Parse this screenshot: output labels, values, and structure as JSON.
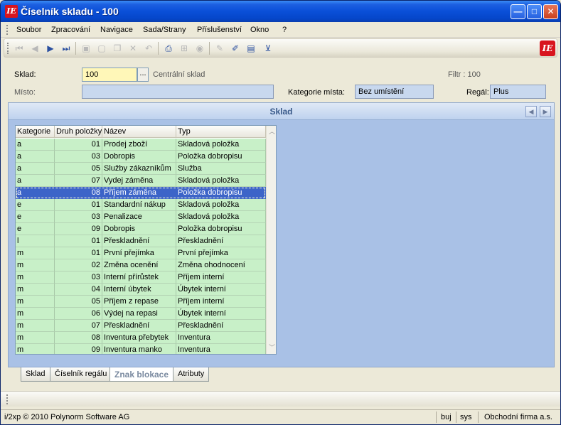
{
  "window": {
    "title": "Číselník skladu - 100",
    "app_logo": "IE"
  },
  "window_buttons": {
    "minimize": "—",
    "maximize": "□",
    "close": "✕"
  },
  "menu": [
    "Soubor",
    "Zpracování",
    "Navigace",
    "Sada/Strany",
    "Příslušenství",
    "Okno",
    "?"
  ],
  "toolbar_icons": [
    "first-icon",
    "previous-icon",
    "next-icon",
    "last-icon",
    "save-icon",
    "new-icon",
    "copy-icon",
    "delete-icon",
    "undo-icon",
    "print-icon",
    "tree-icon",
    "refresh-icon",
    "edit-icon",
    "highlight-icon",
    "form-icon",
    "filter-icon"
  ],
  "form": {
    "sklad_label": "Sklad:",
    "sklad_value": "100",
    "lookup_button": "...",
    "sklad_name": "Centrální sklad",
    "filtr_label": "Filtr : 100",
    "misto_label": "Místo:",
    "misto_value": "",
    "kategorie_label": "Kategorie místa:",
    "kategorie_value": "Bez umístění",
    "regal_label": "Regál:",
    "regal_value": "Plus"
  },
  "panel": {
    "title": "Sklad",
    "nav_prev": "◀",
    "nav_next": "▶"
  },
  "grid": {
    "columns": [
      "Kategorie",
      "Druh položky",
      "Název",
      "Typ"
    ],
    "selected_row": 4,
    "rows": [
      [
        "a",
        "01",
        "Prodej zboží",
        "Skladová položka"
      ],
      [
        "a",
        "03",
        "Dobropis",
        "Položka dobropisu"
      ],
      [
        "a",
        "05",
        "Služby zákazníkům",
        "Služba"
      ],
      [
        "a",
        "07",
        "Vydej záměna",
        "Skladová položka"
      ],
      [
        "a",
        "08",
        "Příjem záměna",
        "Položka dobropisu"
      ],
      [
        "e",
        "01",
        "Standardní nákup",
        "Skladová položka"
      ],
      [
        "e",
        "03",
        "Penalizace",
        "Skladová položka"
      ],
      [
        "e",
        "09",
        "Dobropis",
        "Položka dobropisu"
      ],
      [
        "l",
        "01",
        "Přeskladnění",
        "Přeskladnění"
      ],
      [
        "m",
        "01",
        "První přejímka",
        "První přejímka"
      ],
      [
        "m",
        "02",
        "Změna ocenění",
        "Změna ohodnocení"
      ],
      [
        "m",
        "03",
        "Interní přírůstek",
        "Příjem interní"
      ],
      [
        "m",
        "04",
        "Interní úbytek",
        "Úbytek interní"
      ],
      [
        "m",
        "05",
        "Příjem z repase",
        "Příjem interní"
      ],
      [
        "m",
        "06",
        "Výdej na repasi",
        "Úbytek interní"
      ],
      [
        "m",
        "07",
        "Přeskladnění",
        "Přeskladnění"
      ],
      [
        "m",
        "08",
        "Inventura přebytek",
        "Inventura"
      ],
      [
        "m",
        "09",
        "Inventura manko",
        "Inventura"
      ]
    ]
  },
  "tabs": [
    "Sklad",
    "Číselník regálu",
    "Znak blokace",
    "Atributy"
  ],
  "active_tab": 2,
  "status": {
    "copyright": "i/2xp © 2010 Polynorm Software AG",
    "user": "buj",
    "db": "sys",
    "company": "Obchodní firma a.s."
  },
  "colors": {
    "row_bg": "#c8f0c8",
    "selected_row": "#3c64c8",
    "panel_bg": "#a9c1e6",
    "title_bar": "#0a4fd8"
  }
}
